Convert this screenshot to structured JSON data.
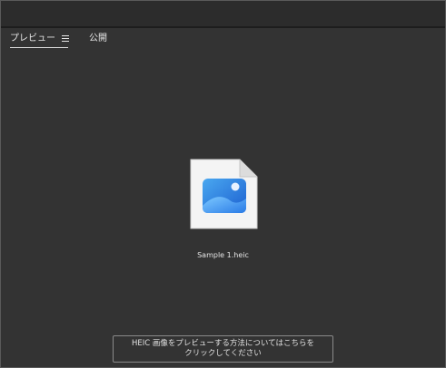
{
  "tabs": {
    "preview_label": "プレビュー",
    "menu_icon": "hamburger-menu-icon",
    "publish_label": "公開"
  },
  "file": {
    "icon": "image-file-icon",
    "name": "Sample 1.heic"
  },
  "help": {
    "line1": "HEIC 画像をプレビューする方法についてはこちらを",
    "line2": "クリックしてください"
  },
  "colors": {
    "background": "#333333",
    "topbar": "#2c2c2c",
    "text": "#e6e6e6",
    "icon_blue": "#1e6fd9"
  }
}
